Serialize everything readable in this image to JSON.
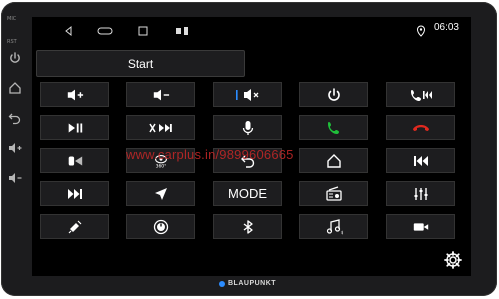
{
  "bezel": {
    "mic_label": "MIC",
    "rst_label": "RST",
    "buttons": [
      "power-icon",
      "home-icon",
      "back-icon",
      "volume-up-icon",
      "volume-down-icon"
    ]
  },
  "statusbar": {
    "time": "06:03",
    "nav_icons": [
      "back-triangle-icon",
      "home-pill-icon",
      "recents-square-icon",
      "notification-icons"
    ],
    "location_icon": "location-pin-icon"
  },
  "start_button": {
    "label": "Start"
  },
  "grid": {
    "rows": [
      [
        "volume-up-icon",
        "volume-down-icon",
        "mute-icon",
        "power-icon",
        "call-previous-icon"
      ],
      [
        "play-pause-icon",
        "mute-next-icon",
        "microphone-icon",
        "call-answer-icon",
        "call-hangup-icon"
      ],
      [
        "camera-view-icon",
        "360-view-icon",
        "back-icon",
        "home-icon",
        "previous-track-icon"
      ],
      [
        "next-track-icon",
        "navigation-icon",
        "MODE",
        "radio-icon",
        "equalizer-icon"
      ],
      [
        "satellite-icon",
        "power-knob-icon",
        "bluetooth-icon",
        "music-icon",
        "video-camera-icon"
      ]
    ]
  },
  "mode_label": "MODE",
  "settings_icon": "gear-icon",
  "brand": {
    "name": "BLAUPUNKT",
    "dot_color": "#2b8cff"
  },
  "watermark": "www.carplus.in/9899606665",
  "colors": {
    "answer": "#1fbf3a",
    "hangup": "#e0291f",
    "accent": "#2b8cff"
  }
}
